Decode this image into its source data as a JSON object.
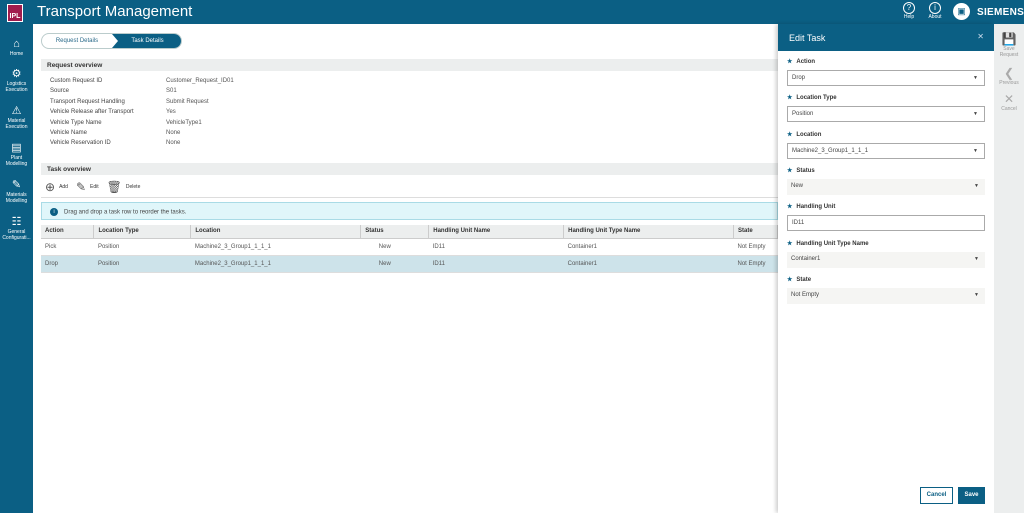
{
  "app": {
    "logo": "IPL",
    "title": "Transport Management",
    "help": "Help",
    "about": "About",
    "brand": "SIEMENS"
  },
  "nav": [
    {
      "label": "Home",
      "icon": "home-icon"
    },
    {
      "label": "Logistics Execution",
      "icon": "logistics-icon"
    },
    {
      "label": "Material Execution",
      "icon": "warning-icon"
    },
    {
      "label": "Plant Modelling",
      "icon": "document-icon"
    },
    {
      "label": "Materials Modelling",
      "icon": "edit-icon"
    },
    {
      "label": "General Configurati...",
      "icon": "sliders-icon"
    }
  ],
  "tabs": [
    "Request Details",
    "Task Details"
  ],
  "request_overview": {
    "title": "Request overview",
    "rows": [
      {
        "k": "Custom Request ID",
        "v": "Customer_Request_ID01"
      },
      {
        "k": "Source",
        "v": "S01"
      },
      {
        "k": "Transport Request Handling",
        "v": "Submit Request"
      },
      {
        "k": "Vehicle Release after Transport",
        "v": "Yes"
      },
      {
        "k": "Vehicle Type Name",
        "v": "VehicleType1"
      },
      {
        "k": "Vehicle Name",
        "v": "None"
      },
      {
        "k": "Vehicle Reservation ID",
        "v": "None"
      }
    ]
  },
  "task_overview": {
    "title": "Task overview",
    "add": "Add",
    "edit": "Edit",
    "delete": "Delete",
    "info": "Drag and drop a task row to reorder the tasks.",
    "columns": [
      "Action",
      "Location Type",
      "Location",
      "Status",
      "Handling Unit Name",
      "Handling Unit Type Name",
      "State"
    ],
    "rows": [
      [
        "Pick",
        "Position",
        "Machine2_3_Group1_1_1_1",
        "New",
        "ID11",
        "Container1",
        "Not Empty"
      ],
      [
        "Drop",
        "Position",
        "Machine2_3_Group1_1_1_1",
        "New",
        "ID11",
        "Container1",
        "Not Empty"
      ]
    ]
  },
  "edit_task": {
    "title": "Edit Task",
    "fields": [
      {
        "label": "Action",
        "value": "Drop"
      },
      {
        "label": "Location Type",
        "value": "Position"
      },
      {
        "label": "Location",
        "value": "Machine2_3_Group1_1_1_1"
      },
      {
        "label": "Status",
        "value": "New"
      },
      {
        "label": "Handling Unit",
        "value": "ID11"
      },
      {
        "label": "Handling Unit Type Name",
        "value": "Container1"
      },
      {
        "label": "State",
        "value": "Not Empty"
      }
    ],
    "cancel": "Cancel",
    "save": "Save"
  },
  "right_bar": {
    "save": "Save Request",
    "previous": "Previous",
    "cancel": "Cancel"
  }
}
